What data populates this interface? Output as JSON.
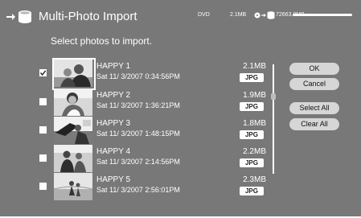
{
  "header": {
    "title": "Multi-Photo Import",
    "source_label": "DVD",
    "selected_size": "2.1MB",
    "free_space": "72663.8MB"
  },
  "subtitle": "Select photos to import.",
  "rows": [
    {
      "name": "HAPPY 1",
      "date": "Sat 11/ 3/2007  0:34:56PM",
      "size": "2.1MB",
      "format": "JPG",
      "checked": true
    },
    {
      "name": "HAPPY 2",
      "date": "Sat 11/ 3/2007  1:36:21PM",
      "size": "1.9MB",
      "format": "JPG",
      "checked": false
    },
    {
      "name": "HAPPY 3",
      "date": "Sat 11/ 3/2007  1:48:15PM",
      "size": "1.8MB",
      "format": "JPG",
      "checked": false
    },
    {
      "name": "HAPPY 4",
      "date": "Sat 11/ 3/2007  2:14:56PM",
      "size": "2.2MB",
      "format": "JPG",
      "checked": false
    },
    {
      "name": "HAPPY 5",
      "date": "Sat 11/ 3/2007  2:56:01PM",
      "size": "2.3MB",
      "format": "JPG",
      "checked": false
    }
  ],
  "buttons": {
    "ok": "OK",
    "cancel": "Cancel",
    "select_all": "Select All",
    "clear_all": "Clear All"
  },
  "colors": {
    "background": "#787878",
    "text": "#ffffff",
    "button": "#d6d6d6"
  },
  "icons": [
    "import-arrow-icon",
    "disk-drive-icon",
    "disc-icon",
    "arrow-right-icon",
    "hard-drive-icon",
    "checkmark-icon"
  ]
}
